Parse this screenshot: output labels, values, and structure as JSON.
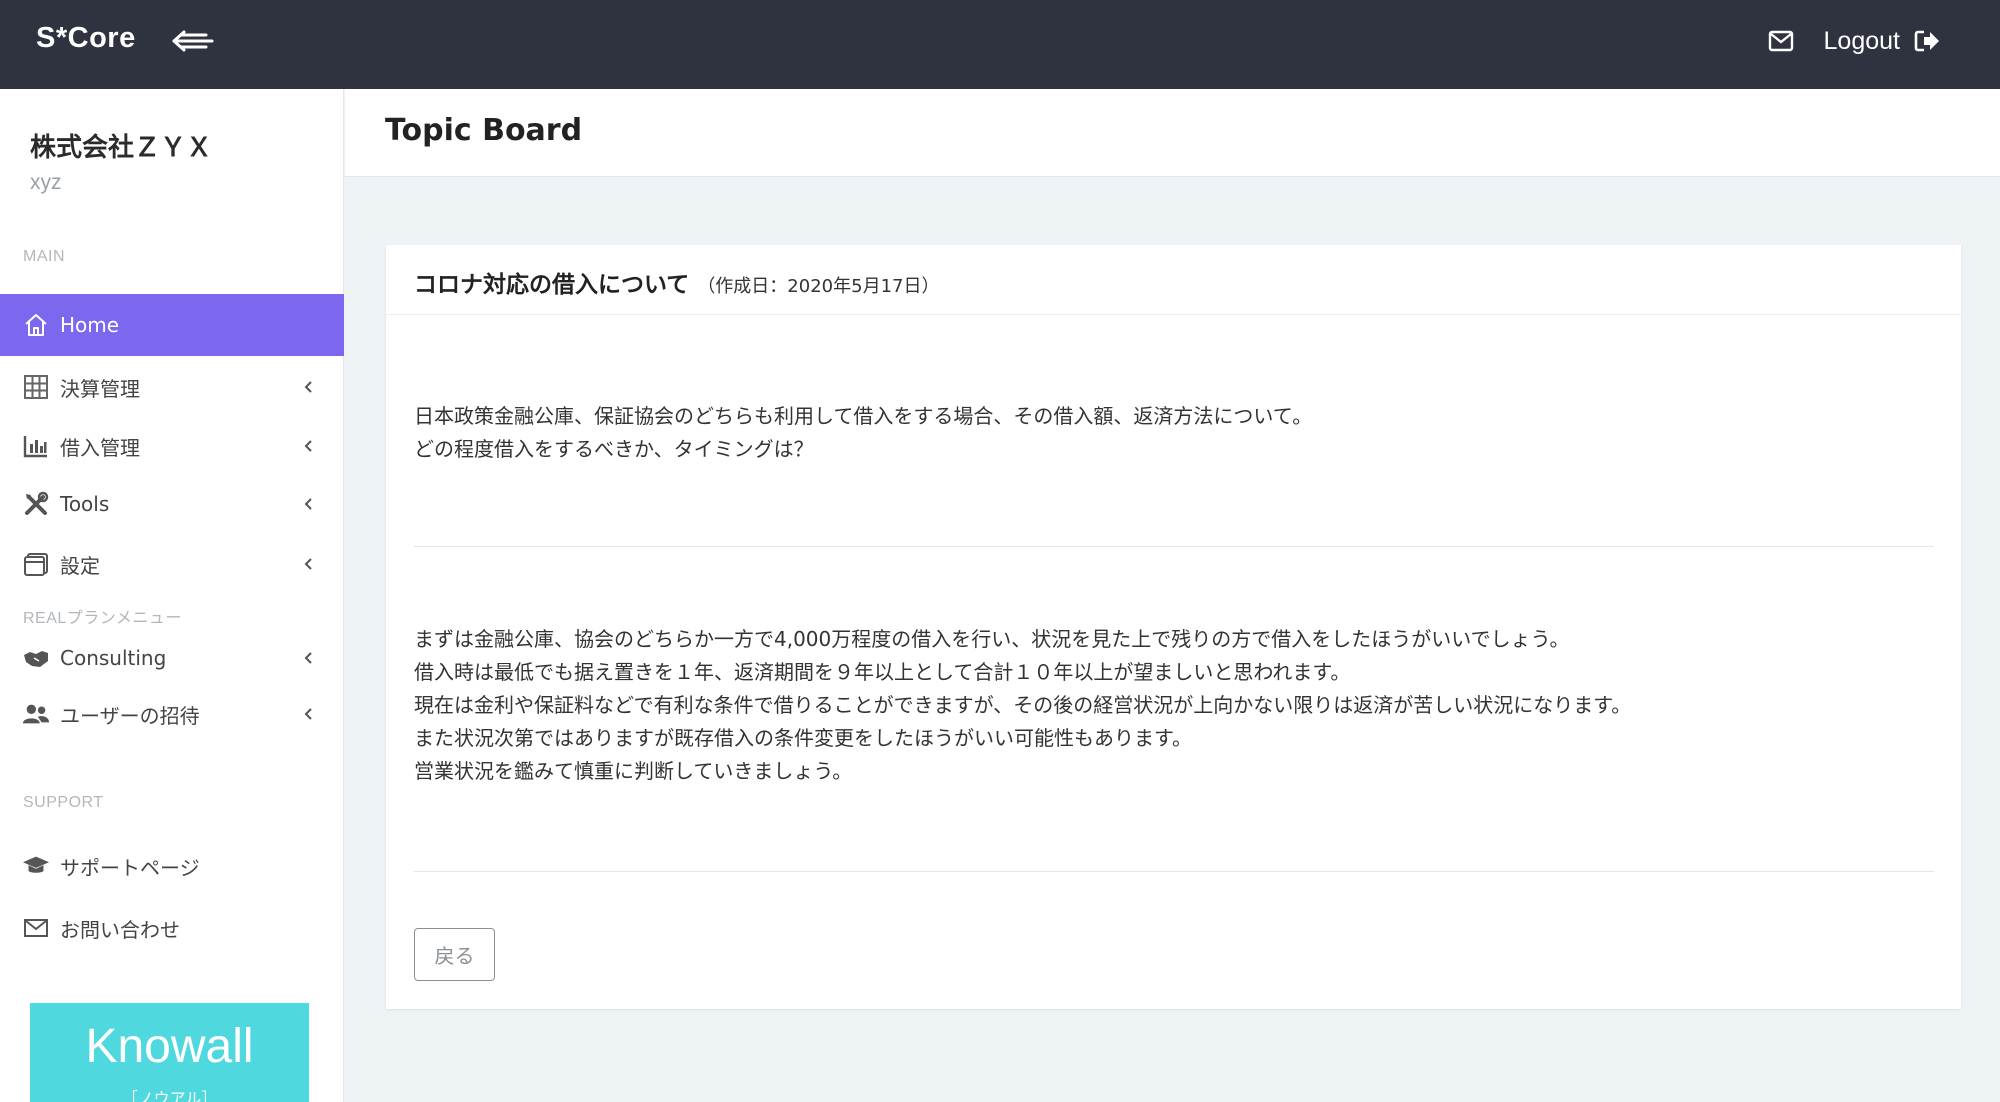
{
  "topbar": {
    "brand": "S*Core",
    "logout_label": "Logout"
  },
  "sidebar": {
    "company_name": "株式会社ＺＹＸ",
    "company_sub": "xyz",
    "section_main": "MAIN",
    "section_real": "REALプランメニュー",
    "section_support": "SUPPORT",
    "items": [
      {
        "label": "Home",
        "icon": "home-icon",
        "active": true
      },
      {
        "label": "決算管理",
        "icon": "table-icon"
      },
      {
        "label": "借入管理",
        "icon": "bar-chart-icon"
      },
      {
        "label": "Tools",
        "icon": "tools-icon"
      },
      {
        "label": "設定",
        "icon": "settings-window-icon"
      },
      {
        "label": "Consulting",
        "icon": "handshake-icon"
      },
      {
        "label": "ユーザーの招待",
        "icon": "users-icon"
      },
      {
        "label": "サポートページ",
        "icon": "graduation-cap-icon"
      },
      {
        "label": "お問い合わせ",
        "icon": "envelope-icon"
      }
    ],
    "banner": {
      "title": "Knowall",
      "subtitle": "［ノウアル］",
      "color": "#4fd9df"
    }
  },
  "content": {
    "page_title": "Topic Board",
    "card": {
      "title": "コロナ対応の借入について",
      "date": "（作成日：2020年5月17日）",
      "question": [
        "日本政策金融公庫、保証協会のどちらも利用して借入をする場合、その借入額、返済方法について。",
        "どの程度借入をするべきか、タイミングは？"
      ],
      "answer": [
        "まずは金融公庫、協会のどちらか一方で4,000万程度の借入を行い、状況を見た上で残りの方で借入をしたほうがいいでしょう。",
        "借入時は最低でも据え置きを１年、返済期間を９年以上として合計１０年以上が望ましいと思われます。",
        "現在は金利や保証料などで有利な条件で借りることができますが、その後の経営状況が上向かない限りは返済が苦しい状況になります。",
        "また状況次第ではありますが既存借入の条件変更をしたほうがいい可能性もあります。",
        "営業状況を鑑みて慎重に判断していきましょう。"
      ],
      "back_label": "戻る"
    }
  },
  "colors": {
    "topbar": "#2f3340",
    "accent": "#7b68ee",
    "background": "#eef3f6"
  }
}
